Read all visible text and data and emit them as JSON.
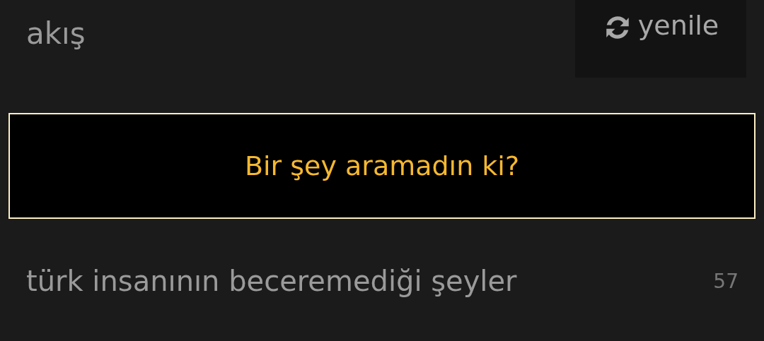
{
  "header": {
    "title": "akış",
    "refresh_button": {
      "label": "yenile"
    }
  },
  "message": "Bir şey aramadın ki?",
  "topics": [
    {
      "title": "türk insanının beceremediği şeyler",
      "count": "57"
    }
  ]
}
